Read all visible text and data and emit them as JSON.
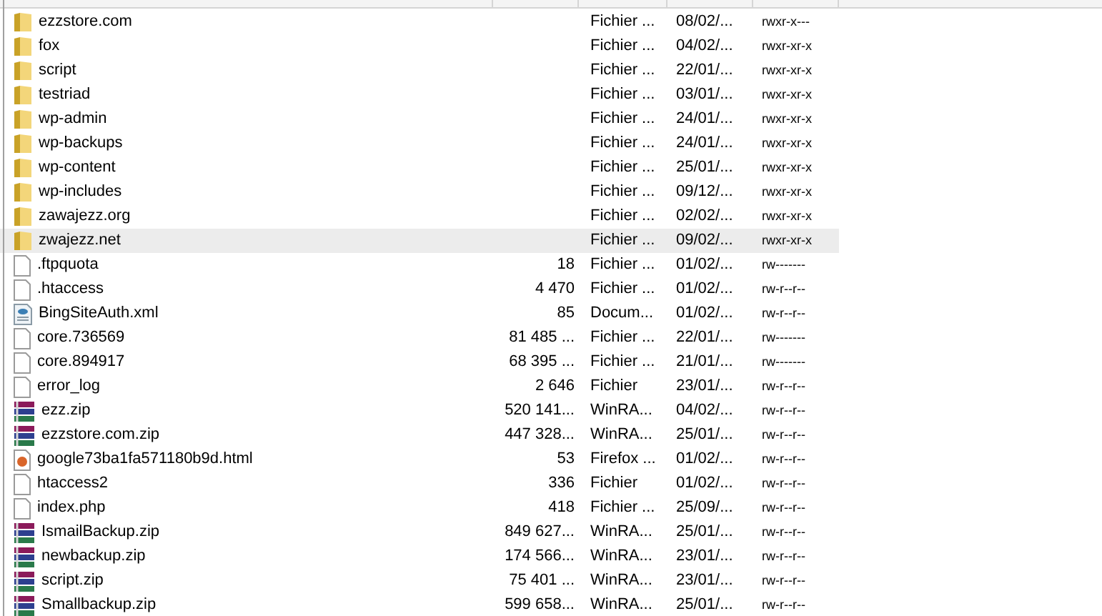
{
  "files": [
    {
      "kind": "folder",
      "name": "ezzstore.com",
      "type": "Fichier ...",
      "modified": "08/02/...",
      "permissions": "rwxr-x---",
      "selected": false
    },
    {
      "kind": "folder",
      "name": "fox",
      "type": "Fichier ...",
      "modified": "04/02/...",
      "permissions": "rwxr-xr-x",
      "selected": false
    },
    {
      "kind": "folder",
      "name": "script",
      "type": "Fichier ...",
      "modified": "22/01/...",
      "permissions": "rwxr-xr-x",
      "selected": false
    },
    {
      "kind": "folder",
      "name": "testriad",
      "type": "Fichier ...",
      "modified": "03/01/...",
      "permissions": "rwxr-xr-x",
      "selected": false
    },
    {
      "kind": "folder",
      "name": "wp-admin",
      "type": "Fichier ...",
      "modified": "24/01/...",
      "permissions": "rwxr-xr-x",
      "selected": false
    },
    {
      "kind": "folder",
      "name": "wp-backups",
      "type": "Fichier ...",
      "modified": "24/01/...",
      "permissions": "rwxr-xr-x",
      "selected": false
    },
    {
      "kind": "folder",
      "name": "wp-content",
      "type": "Fichier ...",
      "modified": "25/01/...",
      "permissions": "rwxr-xr-x",
      "selected": false
    },
    {
      "kind": "folder",
      "name": "wp-includes",
      "type": "Fichier ...",
      "modified": "09/12/...",
      "permissions": "rwxr-xr-x",
      "selected": false
    },
    {
      "kind": "folder",
      "name": "zawajezz.org",
      "type": "Fichier ...",
      "modified": "02/02/...",
      "permissions": "rwxr-xr-x",
      "selected": false
    },
    {
      "kind": "folder",
      "name": "zwajezz.net",
      "type": "Fichier ...",
      "modified": "09/02/...",
      "permissions": "rwxr-xr-x",
      "selected": true
    },
    {
      "kind": "file",
      "name": ".ftpquota",
      "size": "18",
      "type": "Fichier ...",
      "modified": "01/02/...",
      "permissions": "rw-------",
      "selected": false
    },
    {
      "kind": "file",
      "name": ".htaccess",
      "size": "4 470",
      "type": "Fichier ...",
      "modified": "01/02/...",
      "permissions": "rw-r--r--",
      "selected": false
    },
    {
      "kind": "xml",
      "name": "BingSiteAuth.xml",
      "size": "85",
      "type": "Docum...",
      "modified": "01/02/...",
      "permissions": "rw-r--r--",
      "selected": false
    },
    {
      "kind": "file",
      "name": "core.736569",
      "size": "81 485 ...",
      "type": "Fichier ...",
      "modified": "22/01/...",
      "permissions": "rw-------",
      "selected": false
    },
    {
      "kind": "file",
      "name": "core.894917",
      "size": "68 395 ...",
      "type": "Fichier ...",
      "modified": "21/01/...",
      "permissions": "rw-------",
      "selected": false
    },
    {
      "kind": "file",
      "name": "error_log",
      "size": "2 646",
      "type": "Fichier",
      "modified": "23/01/...",
      "permissions": "rw-r--r--",
      "selected": false
    },
    {
      "kind": "zip",
      "name": "ezz.zip",
      "size": "520 141...",
      "type": "WinRA...",
      "modified": "04/02/...",
      "permissions": "rw-r--r--",
      "selected": false
    },
    {
      "kind": "zip",
      "name": "ezzstore.com.zip",
      "size": "447 328...",
      "type": "WinRA...",
      "modified": "25/01/...",
      "permissions": "rw-r--r--",
      "selected": false
    },
    {
      "kind": "html",
      "name": "google73ba1fa571180b9d.html",
      "size": "53",
      "type": "Firefox ...",
      "modified": "01/02/...",
      "permissions": "rw-r--r--",
      "selected": false
    },
    {
      "kind": "file",
      "name": "htaccess2",
      "size": "336",
      "type": "Fichier",
      "modified": "01/02/...",
      "permissions": "rw-r--r--",
      "selected": false
    },
    {
      "kind": "file",
      "name": "index.php",
      "size": "418",
      "type": "Fichier ...",
      "modified": "25/09/...",
      "permissions": "rw-r--r--",
      "selected": false
    },
    {
      "kind": "zip",
      "name": "IsmailBackup.zip",
      "size": "849 627...",
      "type": "WinRA...",
      "modified": "25/01/...",
      "permissions": "rw-r--r--",
      "selected": false
    },
    {
      "kind": "zip",
      "name": "newbackup.zip",
      "size": "174 566...",
      "type": "WinRA...",
      "modified": "23/01/...",
      "permissions": "rw-r--r--",
      "selected": false
    },
    {
      "kind": "zip",
      "name": "script.zip",
      "size": "75 401 ...",
      "type": "WinRA...",
      "modified": "23/01/...",
      "permissions": "rw-r--r--",
      "selected": false
    },
    {
      "kind": "zip",
      "name": "Smallbackup.zip",
      "size": "599 658...",
      "type": "WinRA...",
      "modified": "25/01/...",
      "permissions": "rw-r--r--",
      "selected": false
    }
  ]
}
